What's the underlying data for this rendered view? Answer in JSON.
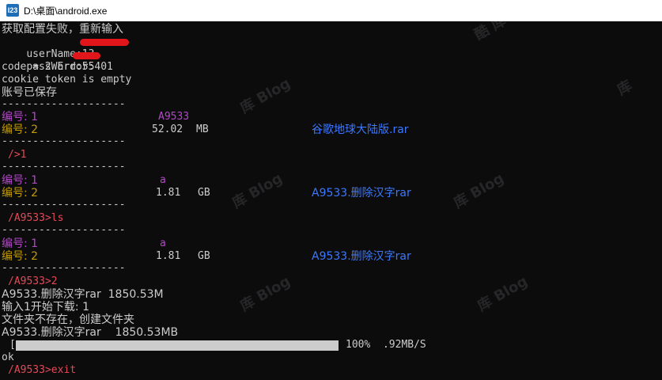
{
  "window": {
    "title": "D:\\桌面\\android.exe",
    "icon": "console-app-icon"
  },
  "console": {
    "l01": "获取配置失败，重新输入",
    "l02": "userName:13",
    "l03": "passWord:55",
    "l04": "code = 2 Error:401",
    "l05": "cookie token is empty",
    "l06": "账号已保存",
    "sep": "--------------------",
    "block1": {
      "r1_label": "编号: 1",
      "r1_name": "A9533",
      "r2_label": "编号: 2",
      "r2_size": "52.02",
      "r2_unit": "MB",
      "r2_file": "谷歌地球大陆版.rar"
    },
    "prompt1": "/>1",
    "block2": {
      "r1_label": "编号: 1",
      "r1_name": "a",
      "r2_label": "编号: 2",
      "r2_size": "1.81",
      "r2_unit": "GB",
      "r2_file": "A9533.删除汉字rar"
    },
    "prompt2": "/A9533>ls",
    "block3": {
      "r1_label": "编号: 1",
      "r1_name": "a",
      "r2_label": "编号: 2",
      "r2_size": "1.81",
      "r2_unit": "GB",
      "r2_file": "A9533.删除汉字rar"
    },
    "prompt3": "/A9533>2",
    "l_file": "A9533.删除汉字rar  1850.53M",
    "l_input": "输入1开始下载: 1",
    "l_mkdir": "文件夹不存在，创建文件夹",
    "l_file2": "A9533.删除汉字rar    1850.53MB",
    "progress": {
      "bracket": "[",
      "percent_text": "100%  .92MB/S",
      "fraction": 1.0
    },
    "ok": "ok",
    "prompt4": "/A9533>exit"
  },
  "colors": {
    "purple": "#b148c6",
    "yellow": "#c19c00",
    "blue": "#3b78ff",
    "red": "#e74856",
    "redaction": "#e0161a"
  }
}
